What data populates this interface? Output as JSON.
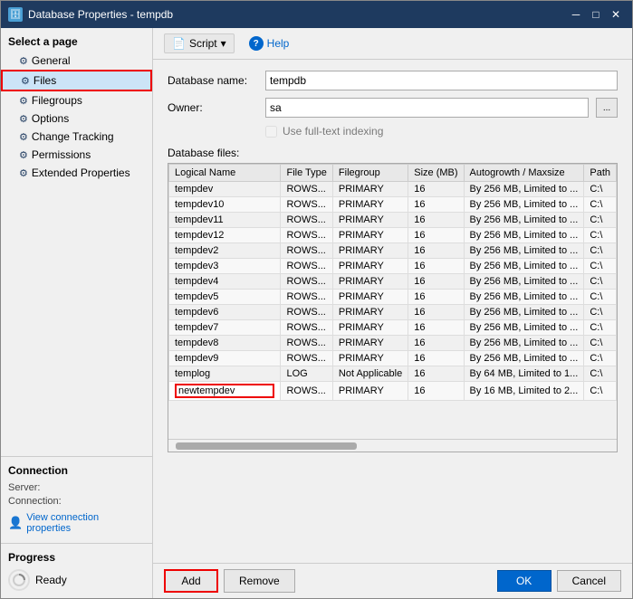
{
  "window": {
    "title": "Database Properties - tempdb",
    "icon": "🗄"
  },
  "titlebar": {
    "minimize": "─",
    "maximize": "□",
    "close": "✕"
  },
  "toolbar": {
    "script_label": "Script",
    "script_arrow": "▾",
    "help_label": "Help"
  },
  "sidebar": {
    "select_page_label": "Select a page",
    "items": [
      {
        "id": "general",
        "label": "General",
        "icon": "⚙"
      },
      {
        "id": "files",
        "label": "Files",
        "icon": "⚙",
        "active": true
      },
      {
        "id": "filegroups",
        "label": "Filegroups",
        "icon": "⚙"
      },
      {
        "id": "options",
        "label": "Options",
        "icon": "⚙"
      },
      {
        "id": "change-tracking",
        "label": "Change Tracking",
        "icon": "⚙"
      },
      {
        "id": "permissions",
        "label": "Permissions",
        "icon": "⚙"
      },
      {
        "id": "extended-properties",
        "label": "Extended Properties",
        "icon": "⚙"
      }
    ],
    "connection": {
      "title": "Connection",
      "server_label": "Server:",
      "server_value": "",
      "connection_label": "Connection:",
      "connection_value": "",
      "view_props_label": "View connection properties"
    },
    "progress": {
      "title": "Progress",
      "status": "Ready"
    }
  },
  "form": {
    "db_name_label": "Database name:",
    "db_name_value": "tempdb",
    "owner_label": "Owner:",
    "owner_value": "sa",
    "browse_btn": "...",
    "full_text_label": "Use full-text indexing",
    "db_files_label": "Database files:"
  },
  "table": {
    "columns": [
      "Logical Name",
      "File Type",
      "Filegroup",
      "Size (MB)",
      "Autogrowth / Maxsize",
      "Path"
    ],
    "rows": [
      {
        "logical_name": "tempdev",
        "file_type": "ROWS...",
        "filegroup": "PRIMARY",
        "size": "16",
        "autogrowth": "By 256 MB, Limited to ...",
        "path": "C:\\"
      },
      {
        "logical_name": "tempdev10",
        "file_type": "ROWS...",
        "filegroup": "PRIMARY",
        "size": "16",
        "autogrowth": "By 256 MB, Limited to ...",
        "path": "C:\\"
      },
      {
        "logical_name": "tempdev11",
        "file_type": "ROWS...",
        "filegroup": "PRIMARY",
        "size": "16",
        "autogrowth": "By 256 MB, Limited to ...",
        "path": "C:\\"
      },
      {
        "logical_name": "tempdev12",
        "file_type": "ROWS...",
        "filegroup": "PRIMARY",
        "size": "16",
        "autogrowth": "By 256 MB, Limited to ...",
        "path": "C:\\"
      },
      {
        "logical_name": "tempdev2",
        "file_type": "ROWS...",
        "filegroup": "PRIMARY",
        "size": "16",
        "autogrowth": "By 256 MB, Limited to ...",
        "path": "C:\\"
      },
      {
        "logical_name": "tempdev3",
        "file_type": "ROWS...",
        "filegroup": "PRIMARY",
        "size": "16",
        "autogrowth": "By 256 MB, Limited to ...",
        "path": "C:\\"
      },
      {
        "logical_name": "tempdev4",
        "file_type": "ROWS...",
        "filegroup": "PRIMARY",
        "size": "16",
        "autogrowth": "By 256 MB, Limited to ...",
        "path": "C:\\"
      },
      {
        "logical_name": "tempdev5",
        "file_type": "ROWS...",
        "filegroup": "PRIMARY",
        "size": "16",
        "autogrowth": "By 256 MB, Limited to ...",
        "path": "C:\\"
      },
      {
        "logical_name": "tempdev6",
        "file_type": "ROWS...",
        "filegroup": "PRIMARY",
        "size": "16",
        "autogrowth": "By 256 MB, Limited to ...",
        "path": "C:\\"
      },
      {
        "logical_name": "tempdev7",
        "file_type": "ROWS...",
        "filegroup": "PRIMARY",
        "size": "16",
        "autogrowth": "By 256 MB, Limited to ...",
        "path": "C:\\"
      },
      {
        "logical_name": "tempdev8",
        "file_type": "ROWS...",
        "filegroup": "PRIMARY",
        "size": "16",
        "autogrowth": "By 256 MB, Limited to ...",
        "path": "C:\\"
      },
      {
        "logical_name": "tempdev9",
        "file_type": "ROWS...",
        "filegroup": "PRIMARY",
        "size": "16",
        "autogrowth": "By 256 MB, Limited to ...",
        "path": "C:\\"
      },
      {
        "logical_name": "templog",
        "file_type": "LOG",
        "filegroup": "Not Applicable",
        "size": "16",
        "autogrowth": "By 64 MB, Limited to 1...",
        "path": "C:\\"
      },
      {
        "logical_name": "newtempdev",
        "file_type": "ROWS...",
        "filegroup": "PRIMARY",
        "size": "16",
        "autogrowth": "By 16 MB, Limited to 2...",
        "path": "C:\\",
        "editing": true
      }
    ]
  },
  "bottom": {
    "add_label": "Add",
    "remove_label": "Remove",
    "ok_label": "OK",
    "cancel_label": "Cancel"
  },
  "colors": {
    "highlight_border": "#cc0000",
    "active_sidebar_bg": "#cce4f7",
    "title_bar_bg": "#1e3a5f"
  }
}
